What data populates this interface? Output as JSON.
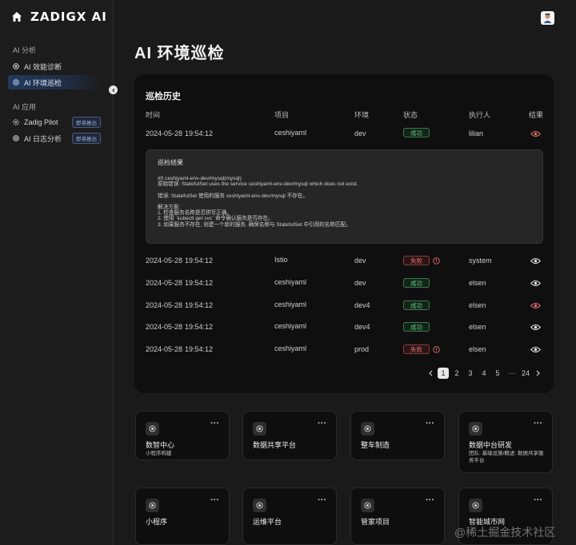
{
  "brand": {
    "logo_text": "ZADIGX AI"
  },
  "sidebar": {
    "section1": "AI 分析",
    "item_diag": "AI 效能诊断",
    "item_patrol": "AI 环境巡检",
    "section2": "AI 应用",
    "item_pilot": "Zadig Pilot",
    "item_log": "AI 日志分析",
    "soon_label": "即将推出"
  },
  "page": {
    "title": "AI 环境巡检"
  },
  "history": {
    "title": "巡检历史",
    "headers": {
      "time": "时间",
      "project": "项目",
      "env": "环境",
      "status": "状态",
      "executor": "执行人",
      "result": "结果"
    },
    "rows": [
      {
        "date": "2024-05-28",
        "time": "19:54:12",
        "project": "ceshiyaml",
        "env": "dev",
        "status": "成功",
        "executor": "lilian"
      },
      {
        "date": "2024-05-28",
        "time": "19:54:12",
        "project": "Istio",
        "env": "dev",
        "status": "失败",
        "executor": "system"
      },
      {
        "date": "2024-05-28",
        "time": "19:54:12",
        "project": "ceshiyaml",
        "env": "dev",
        "status": "成功",
        "executor": "elsen"
      },
      {
        "date": "2024-05-28",
        "time": "19:54:12",
        "project": "ceshiyaml",
        "env": "dev4",
        "status": "成功",
        "executor": "elsen"
      },
      {
        "date": "2024-05-28",
        "time": "19:54:12",
        "project": "ceshiyaml",
        "env": "dev4",
        "status": "成功",
        "executor": "elsen"
      },
      {
        "date": "2024-05-28",
        "time": "19:54:12",
        "project": "ceshiyaml",
        "env": "prod",
        "status": "失败",
        "executor": "elsen"
      }
    ],
    "detail": {
      "title": "巡检结果",
      "line1": "#0 ceshiyaml-env-dev/mysql(mysql)",
      "line2": "原始错误: StatefulSet uses the service ceshiyaml-env-dev/mysql which does not exist.",
      "line3": "错误: StatefulSet 使用的服务 ceshiyaml-env-dev/mysql 不存在。",
      "line4": "解决方案:",
      "line5": "1. 检查服务名称是否拼写正确。",
      "line6": "2. 使用 `kubectl get svc` 命令确认服务是否存在。",
      "line7": "3. 如果服务不存在, 创建一个新的服务, 确保名称与 StatefulSet 中引用的名称匹配。"
    },
    "pagination": {
      "p1": "1",
      "p2": "2",
      "p3": "3",
      "p4": "4",
      "p5": "5",
      "ellipsis": "···",
      "last": "24"
    }
  },
  "cards": [
    {
      "title": "数智中心",
      "subtitle": "小程序构建"
    },
    {
      "title": "数据共享平台",
      "subtitle": ""
    },
    {
      "title": "整车制造",
      "subtitle": ""
    },
    {
      "title": "数据中台研发",
      "subtitle": "团队: 基础设施/概述: 数据共享服务平台"
    },
    {
      "title": "小程序",
      "subtitle": ""
    },
    {
      "title": "运维平台",
      "subtitle": ""
    },
    {
      "title": "管家项目",
      "subtitle": ""
    },
    {
      "title": "智能城市网",
      "subtitle": ""
    }
  ],
  "more_label": "···",
  "watermark": "@稀土掘金技术社区",
  "colors": {
    "success": "#5ecb7a",
    "fail": "#e2706c",
    "accent": "#2b4a7a",
    "eye_alert": "#e2706c"
  }
}
